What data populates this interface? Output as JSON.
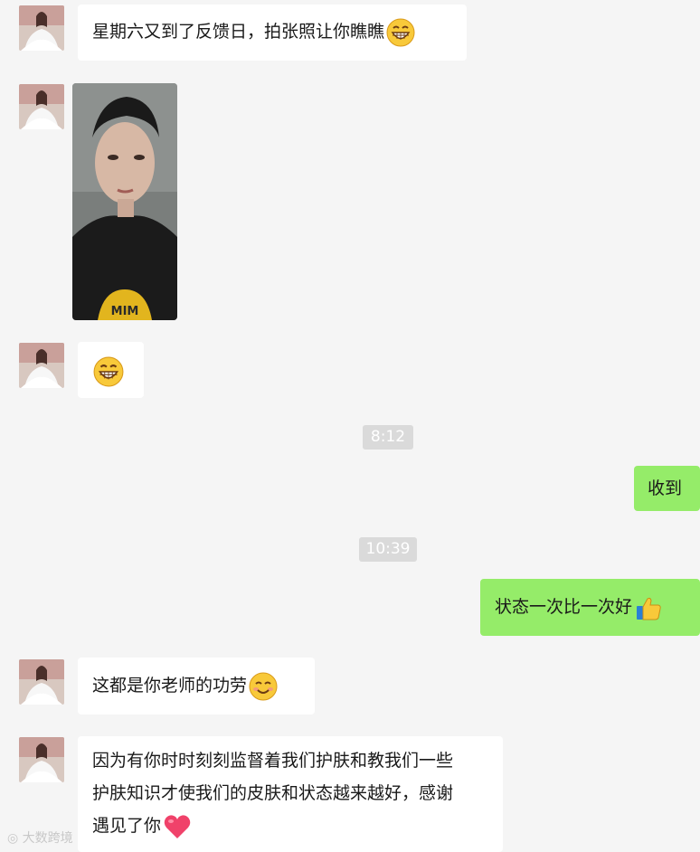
{
  "chat": {
    "messages": [
      {
        "sender": "contact",
        "text": "星期六又到了反馈日，拍张照让你瞧瞧",
        "emoji": "grin-emoji"
      },
      {
        "sender": "contact",
        "type": "photo",
        "photo_text": "MIM"
      },
      {
        "sender": "contact",
        "text": "",
        "emoji": "grin-emoji"
      },
      {
        "type": "timestamp",
        "text": "8:12"
      },
      {
        "sender": "self",
        "text": "收到"
      },
      {
        "type": "timestamp",
        "text": "10:39"
      },
      {
        "sender": "self",
        "text": "状态一次比一次好",
        "emoji": "thumbs-up-emoji"
      },
      {
        "sender": "contact",
        "text": "这都是你老师的功劳",
        "emoji": "smile-emoji"
      },
      {
        "sender": "contact",
        "lines": [
          "因为有你时时刻刻监督着我们护肤和教我们一些",
          "护肤知识才使我们的皮肤和状态越来越好，感谢",
          "遇见了你"
        ],
        "emoji": "heart-emoji"
      }
    ]
  },
  "watermark": "大数跨境",
  "colors": {
    "background": "#f5f5f5",
    "self_bubble": "#95ec69",
    "contact_bubble": "#ffffff",
    "timestamp_bg": "#dadada"
  }
}
